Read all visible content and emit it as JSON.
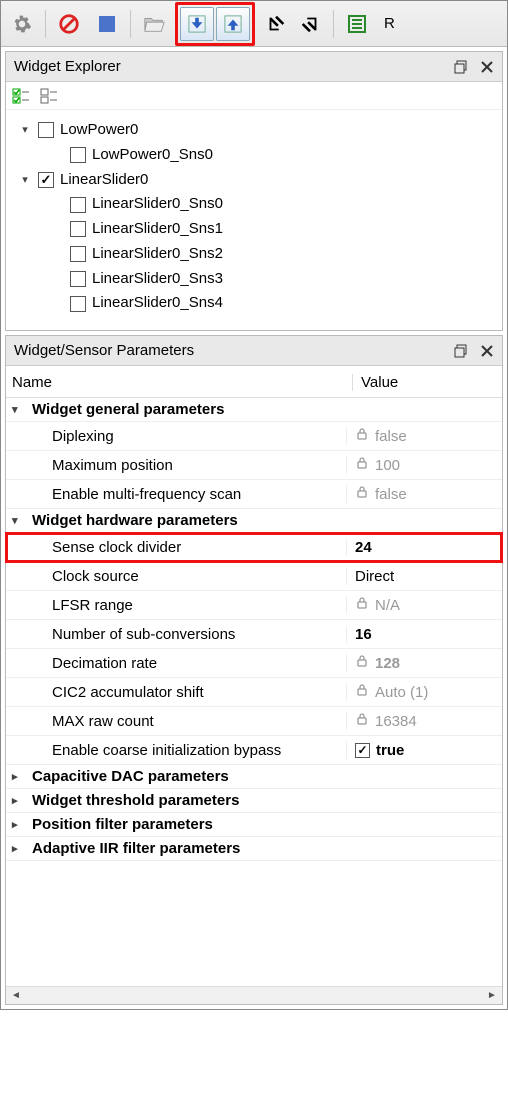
{
  "toolbar": {
    "trailing_text": "R"
  },
  "explorer": {
    "title": "Widget Explorer",
    "tree": [
      {
        "id": "lp0",
        "label": "LowPower0",
        "depth": 0,
        "expander": "open",
        "checked": false
      },
      {
        "id": "lp0s0",
        "label": "LowPower0_Sns0",
        "depth": 1,
        "expander": "none",
        "checked": false
      },
      {
        "id": "ls0",
        "label": "LinearSlider0",
        "depth": 0,
        "expander": "open",
        "checked": true
      },
      {
        "id": "ls0s0",
        "label": "LinearSlider0_Sns0",
        "depth": 1,
        "expander": "none",
        "checked": false
      },
      {
        "id": "ls0s1",
        "label": "LinearSlider0_Sns1",
        "depth": 1,
        "expander": "none",
        "checked": false
      },
      {
        "id": "ls0s2",
        "label": "LinearSlider0_Sns2",
        "depth": 1,
        "expander": "none",
        "checked": false
      },
      {
        "id": "ls0s3",
        "label": "LinearSlider0_Sns3",
        "depth": 1,
        "expander": "none",
        "checked": false
      },
      {
        "id": "ls0s4",
        "label": "LinearSlider0_Sns4",
        "depth": 1,
        "expander": "none",
        "checked": false
      }
    ]
  },
  "params": {
    "title": "Widget/Sensor Parameters",
    "col_name": "Name",
    "col_value": "Value",
    "groups": [
      {
        "label": "Widget general parameters",
        "expanded": true,
        "rows": [
          {
            "name": "Diplexing",
            "value": "false",
            "locked": true,
            "bold": false,
            "checkbox": false,
            "highlight": false
          },
          {
            "name": "Maximum position",
            "value": "100",
            "locked": true,
            "bold": false,
            "checkbox": false,
            "highlight": false
          },
          {
            "name": "Enable multi-frequency scan",
            "value": "false",
            "locked": true,
            "bold": false,
            "checkbox": false,
            "highlight": false
          }
        ]
      },
      {
        "label": "Widget hardware parameters",
        "expanded": true,
        "rows": [
          {
            "name": "Sense clock divider",
            "value": "24",
            "locked": false,
            "bold": true,
            "checkbox": false,
            "highlight": true
          },
          {
            "name": "Clock source",
            "value": "Direct",
            "locked": false,
            "bold": false,
            "checkbox": false,
            "highlight": false
          },
          {
            "name": "LFSR range",
            "value": "N/A",
            "locked": true,
            "bold": false,
            "checkbox": false,
            "highlight": false
          },
          {
            "name": "Number of sub-conversions",
            "value": "16",
            "locked": false,
            "bold": true,
            "checkbox": false,
            "highlight": false
          },
          {
            "name": "Decimation rate",
            "value": "128",
            "locked": true,
            "bold": true,
            "checkbox": false,
            "highlight": false
          },
          {
            "name": "CIC2 accumulator shift",
            "value": "Auto (1)",
            "locked": true,
            "bold": false,
            "checkbox": false,
            "highlight": false
          },
          {
            "name": "MAX raw count",
            "value": "16384",
            "locked": true,
            "bold": false,
            "checkbox": false,
            "highlight": false
          },
          {
            "name": "Enable coarse initialization bypass",
            "value": "true",
            "locked": false,
            "bold": true,
            "checkbox": true,
            "highlight": false
          }
        ]
      },
      {
        "label": "Capacitive DAC parameters",
        "expanded": false,
        "rows": []
      },
      {
        "label": "Widget threshold parameters",
        "expanded": false,
        "rows": []
      },
      {
        "label": "Position filter parameters",
        "expanded": false,
        "rows": []
      },
      {
        "label": "Adaptive IIR filter parameters",
        "expanded": false,
        "rows": []
      }
    ]
  }
}
